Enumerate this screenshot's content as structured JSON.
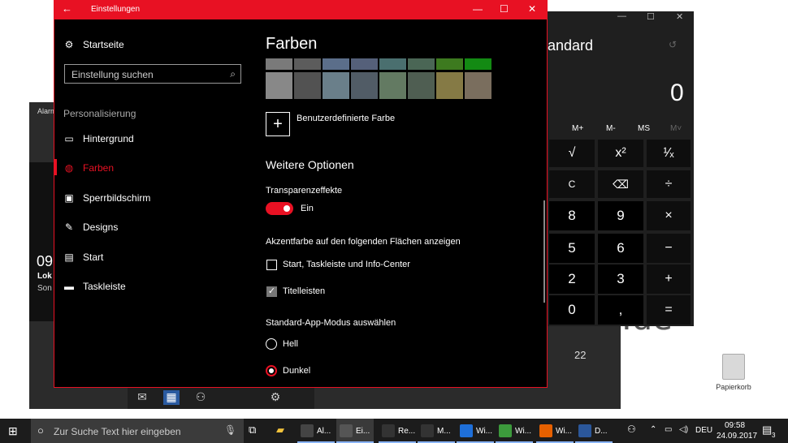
{
  "desktop": {
    "watermark": ".de",
    "recycle_bin_label": "Papierkorb"
  },
  "alarm": {
    "title": "Alarm",
    "time": "09",
    "label1": "Lok",
    "label2": "Son",
    "number": "22"
  },
  "calculator": {
    "title": "andard",
    "display": "0",
    "memory": [
      "M+",
      "M-",
      "MS",
      "M˅"
    ],
    "keys": {
      "row1": [
        "√",
        "x²",
        "¹⁄ₓ"
      ],
      "row2": [
        "C",
        "⌫",
        "÷"
      ],
      "row3": [
        "8",
        "9",
        "×"
      ],
      "row4": [
        "5",
        "6",
        "−"
      ],
      "row5": [
        "2",
        "3",
        "+"
      ],
      "row6": [
        "0",
        ",",
        "="
      ]
    },
    "controls": {
      "minimize": "—",
      "maximize": "☐",
      "close": "✕"
    }
  },
  "settings": {
    "window_title": "Einstellungen",
    "back": "←",
    "controls": {
      "minimize": "—",
      "maximize": "☐",
      "close": "✕"
    },
    "home": "Startseite",
    "search_placeholder": "Einstellung suchen",
    "section": "Personalisierung",
    "nav": [
      {
        "label": "Hintergrund",
        "icon": "picture-icon"
      },
      {
        "label": "Farben",
        "icon": "palette-icon",
        "active": true
      },
      {
        "label": "Sperrbildschirm",
        "icon": "lockscreen-icon"
      },
      {
        "label": "Designs",
        "icon": "brush-icon"
      },
      {
        "label": "Start",
        "icon": "start-icon"
      },
      {
        "label": "Taskleiste",
        "icon": "taskbar-icon"
      }
    ],
    "page_title": "Farben",
    "swatches_row1": [
      "#7a7a7a",
      "#5c5c5c",
      "#5b6e8a",
      "#55607a",
      "#4a6f6f",
      "#4a6655",
      "#3d7a1f",
      "#138a13"
    ],
    "swatches_row2": [
      "#888888",
      "#525252",
      "#6a7f8a",
      "#515c66",
      "#637a62",
      "#4f5e52",
      "#857a45",
      "#7a6e5e"
    ],
    "custom_color": "Benutzerdefinierte Farbe",
    "more_options": "Weitere Optionen",
    "transparency_label": "Transparenzeffekte",
    "transparency_value": "Ein",
    "accent_label": "Akzentfarbe auf den folgenden Flächen anzeigen",
    "accent_option1": "Start, Taskleiste und Info-Center",
    "accent_option2": "Titelleisten",
    "mode_label": "Standard-App-Modus auswählen",
    "mode_light": "Hell",
    "mode_dark": "Dunkel",
    "accent_color": "#e81123"
  },
  "taskbar": {
    "search_placeholder": "Zur Suche Text hier eingeben",
    "apps": [
      {
        "label": "Al...",
        "icon": "alarm-icon",
        "color": "#444"
      },
      {
        "label": "Ei...",
        "icon": "settings-icon",
        "color": "#555"
      },
      {
        "label": "Re...",
        "icon": "calculator-icon",
        "color": "#333"
      },
      {
        "label": "M...",
        "icon": "calendar-icon",
        "color": "#333"
      },
      {
        "label": "Wi...",
        "icon": "edge-icon",
        "color": "#1e6fd9"
      },
      {
        "label": "Wi...",
        "icon": "chrome-icon",
        "color": "#3c9a3c"
      },
      {
        "label": "Wi...",
        "icon": "firefox-icon",
        "color": "#e66000"
      },
      {
        "label": "D...",
        "icon": "word-icon",
        "color": "#2b579a"
      }
    ],
    "tray": {
      "lang": "DEU",
      "time": "09:58",
      "date": "24.09.2017",
      "notif_count": "3"
    }
  }
}
